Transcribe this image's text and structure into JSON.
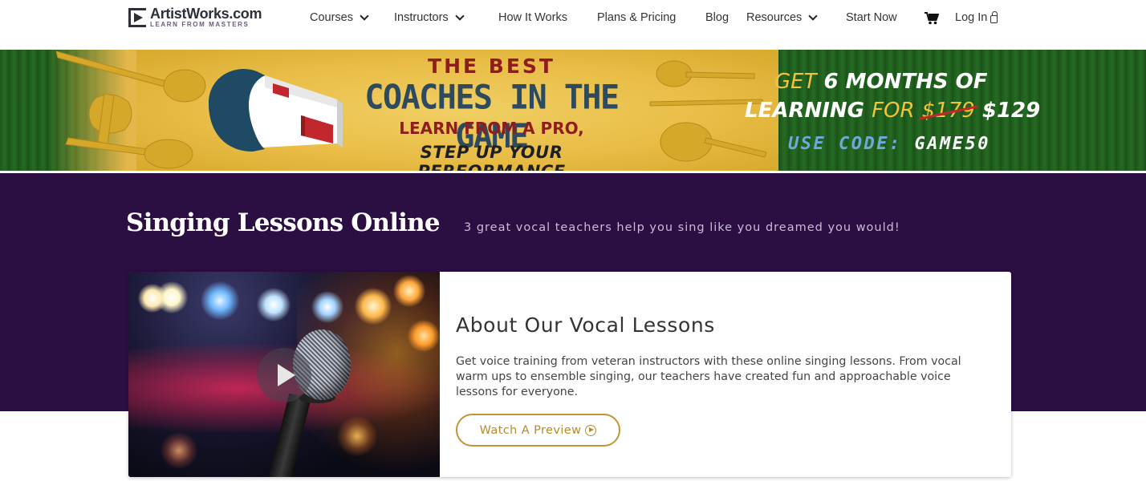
{
  "header": {
    "logo_name": "ArtistWorks.com",
    "logo_tagline": "LEARN FROM MASTERS",
    "nav": {
      "courses": "Courses",
      "instructors": "Instructors",
      "how_it_works": "How It Works",
      "plans_pricing": "Plans & Pricing",
      "blog": "Blog",
      "resources": "Resources",
      "start_now": "Start Now",
      "login": "Log In"
    },
    "icons": {
      "cart": "shopping-cart-icon",
      "lock": "lock-icon",
      "dropdown": "chevron-down-icon"
    }
  },
  "banner": {
    "line1": "THE BEST",
    "line2": "COACHES IN THE GAME",
    "line3": "LEARN FROM A PRO,",
    "line4": "STEP UP YOUR PERFORMANCE",
    "offer_get": "GET",
    "offer_months": "6 MONTHS OF",
    "offer_learning": "LEARNING",
    "offer_for": "FOR",
    "old_price": "$179",
    "new_price": "$129",
    "code_label": "USE CODE:",
    "code": "GAME50",
    "colors": {
      "grass": "#1e5a1e",
      "gold": "#e9bd47",
      "red": "#8e1e1e",
      "slate": "#2e4a5e"
    }
  },
  "hero": {
    "title": "Singing Lessons Online",
    "subtitle": "3 great vocal teachers help you sing like you dreamed you would!",
    "background": "#2b0e42"
  },
  "card": {
    "title": "About Our Vocal Lessons",
    "description": "Get voice training from veteran instructors with these online singing lessons. From vocal warm ups to ensemble singing, our teachers have created fun and approachable voice lessons for everyone.",
    "button_label": "Watch A Preview",
    "accent": "#c19436",
    "icons": {
      "play": "play-icon",
      "circle_play": "circle-play-icon"
    }
  }
}
